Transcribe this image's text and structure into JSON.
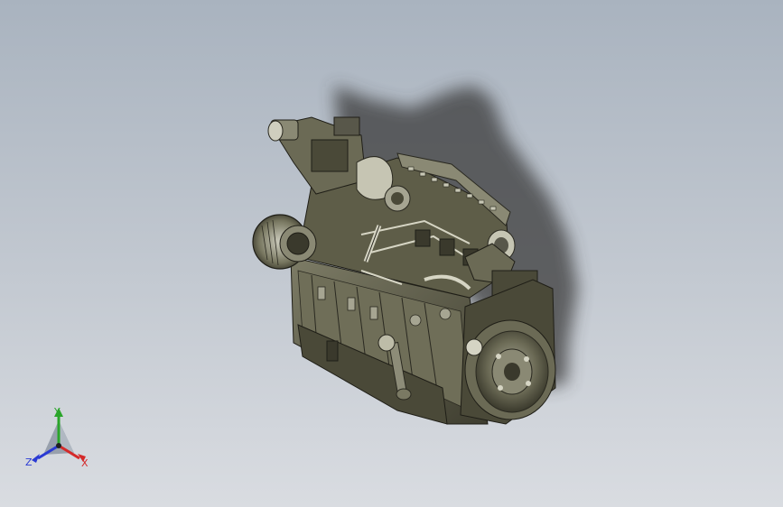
{
  "viewport": {
    "background_top": "#a9b3bf",
    "background_bottom": "#d9dce1"
  },
  "model": {
    "body_color": "#5e5d48",
    "dark_color": "#2f2e24",
    "highlight_color": "#d5d4c4",
    "shadow_color": "#3b3b3b"
  },
  "triad": {
    "x_label": "X",
    "y_label": "Y",
    "z_label": "Z",
    "x_color": "#d42a2a",
    "y_color": "#2aa52a",
    "z_color": "#2a3ad4"
  }
}
